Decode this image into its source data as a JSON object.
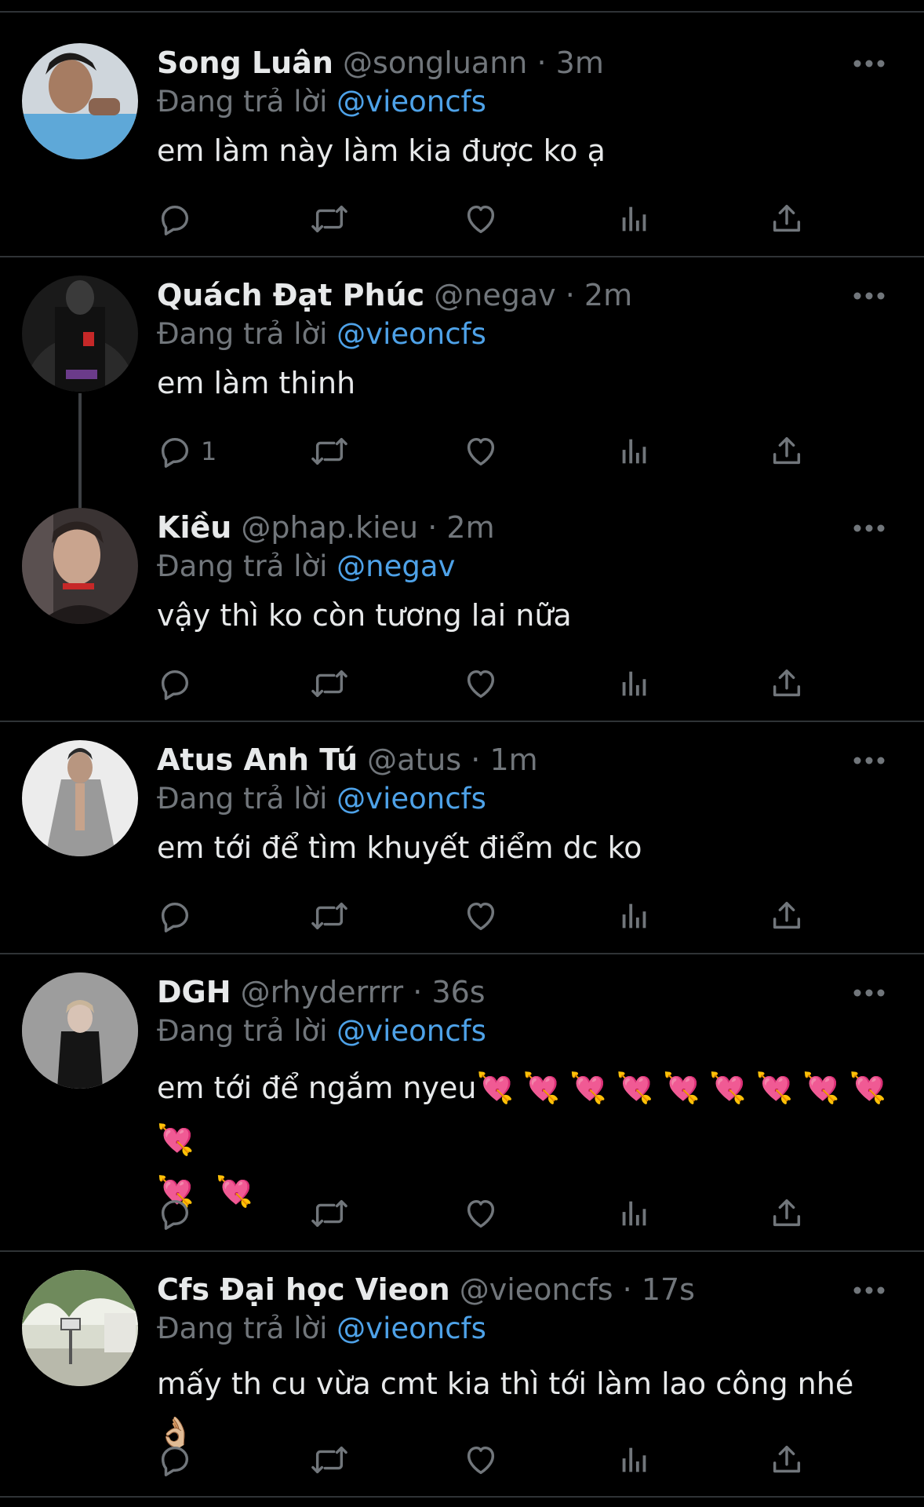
{
  "reply_prefix": "Đang trả lời",
  "tweets": [
    {
      "name": "Song Luân",
      "handle": "@songluann",
      "sep": "·",
      "time": "3m",
      "reply_to": "@vieoncfs",
      "text": "em làm này làm kia được ko ạ",
      "reply_count": ""
    },
    {
      "name": "Quách Đạt Phúc",
      "handle": "@negav",
      "sep": "·",
      "time": "2m",
      "reply_to": "@vieoncfs",
      "text": "em làm thinh",
      "reply_count": "1"
    },
    {
      "name": "Kiều",
      "handle": "@phap.kieu",
      "sep": "·",
      "time": "2m",
      "reply_to": "@negav",
      "text": "vậy thì ko còn tương lai nữa",
      "reply_count": ""
    },
    {
      "name": "Atus Anh Tú",
      "handle": "@atus",
      "sep": "·",
      "time": "1m",
      "reply_to": "@vieoncfs",
      "text": "em tới để tìm khuyết điểm dc ko",
      "reply_count": ""
    },
    {
      "name": "DGH",
      "handle": "@rhyderrrr",
      "sep": "·",
      "time": "36s",
      "reply_to": "@vieoncfs",
      "text": "em tới để ngắm nyeu💘 💘 💘 💘 💘 💘 💘 💘 💘 💘",
      "text_line2": "💘 💘",
      "reply_count": ""
    },
    {
      "name": "Cfs Đại học Vieon",
      "handle": "@vieoncfs",
      "sep": "·",
      "time": "17s",
      "reply_to": "@vieoncfs",
      "text": "mấy th cu vừa cmt kia thì tới làm lao công nhé 👌🏼",
      "reply_count": ""
    }
  ],
  "icons": {
    "reply": "reply-icon",
    "retweet": "retweet-icon",
    "like": "heart-icon",
    "views": "analytics-icon",
    "share": "share-icon",
    "more": "more-icon"
  },
  "colors": {
    "background": "#000000",
    "separator": "#2f3336",
    "text": "#e7e9ea",
    "secondary": "#71767b",
    "link": "#4ea2e8"
  }
}
